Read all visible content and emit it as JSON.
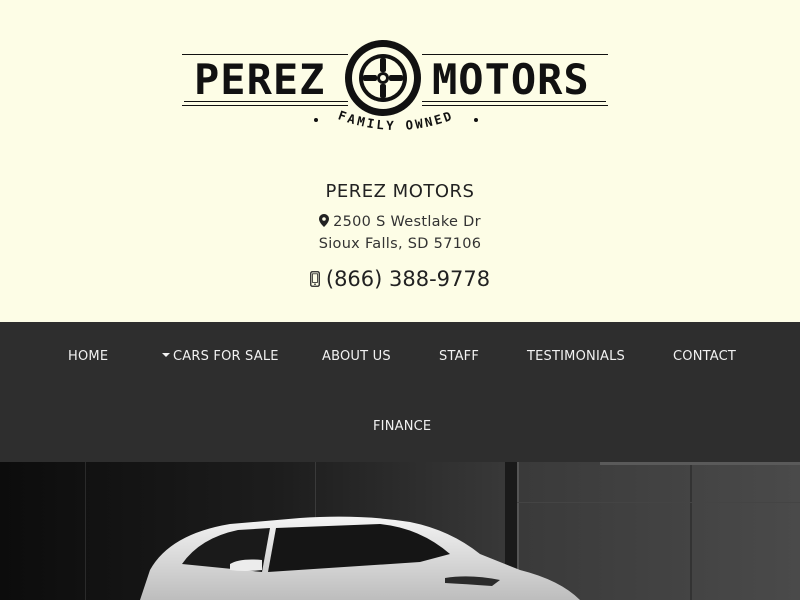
{
  "logo": {
    "word_left": "PEREZ",
    "word_right": "MOTORS",
    "tagline": "FAMILY OWNED"
  },
  "business": {
    "name": "PEREZ MOTORS",
    "address_line1": "2500 S Westlake Dr",
    "address_line2": "Sioux Falls, SD 57106",
    "phone": "(866) 388-9778"
  },
  "nav": {
    "items": [
      {
        "label": "HOME"
      },
      {
        "label": "CARS FOR SALE"
      },
      {
        "label": "ABOUT US"
      },
      {
        "label": "STAFF"
      },
      {
        "label": "TESTIMONIALS"
      },
      {
        "label": "CONTACT"
      },
      {
        "label": "FINANCE"
      }
    ]
  },
  "icons": {
    "wheel": "wheel-icon",
    "pin": "map-pin-icon",
    "phone": "mobile-phone-icon",
    "dropdown": "caret-down-icon"
  },
  "colors": {
    "header_bg": "#fdfde6",
    "nav_bg": "#2e2e2e",
    "nav_text": "#f2f2f2",
    "logo_ink": "#111111"
  }
}
